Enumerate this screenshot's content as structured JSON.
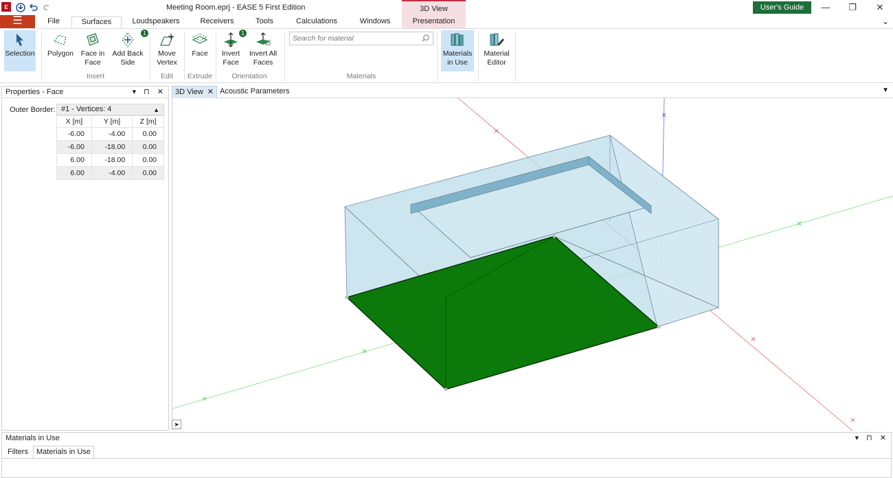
{
  "window": {
    "title": "Meeting Room.eprj - EASE 5 First Edition",
    "context_tab_group": "3D View",
    "users_guide": "User's Guide",
    "controls": {
      "minimize": "—",
      "restore": "❐",
      "close": "✕"
    }
  },
  "menu_tabs": [
    {
      "label": "File"
    },
    {
      "label": "Surfaces"
    },
    {
      "label": "Loudspeakers"
    },
    {
      "label": "Receivers"
    },
    {
      "label": "Tools"
    },
    {
      "label": "Calculations"
    },
    {
      "label": "Windows"
    },
    {
      "label": "Presentation"
    }
  ],
  "ribbon": {
    "selection": "Selection",
    "polygon": "Polygon",
    "face_in_face_1": "Face in",
    "face_in_face_2": "Face",
    "add_back_side_1": "Add Back",
    "add_back_side_2": "Side",
    "move_vertex_1": "Move",
    "move_vertex_2": "Vertex",
    "face": "Face",
    "invert_face_1": "Invert",
    "invert_face_2": "Face",
    "invert_all_1": "Invert All",
    "invert_all_2": "Faces",
    "materials_in_use_1": "Materials",
    "materials_in_use_2": "in Use",
    "material_editor_1": "Material",
    "material_editor_2": "Editor",
    "badge_add_back": "1",
    "badge_invert": "1",
    "groups": {
      "insert": "Insert",
      "edit": "Edit",
      "extrude": "Extrude",
      "orientation": "Orientation",
      "materials": "Materials"
    },
    "search_placeholder": "Search for material"
  },
  "properties": {
    "title": "Properties - Face",
    "controls": "▾ ⊓ ✕",
    "outer_border_label": "Outer Border:",
    "outer_border_value": "#1 - Vertices: 4",
    "columns": [
      "X [m]",
      "Y [m]",
      "Z [m]"
    ],
    "rows": [
      [
        "-6.00",
        "-4.00",
        "0.00"
      ],
      [
        "-6.00",
        "-18.00",
        "0.00"
      ],
      [
        "6.00",
        "-18.00",
        "0.00"
      ],
      [
        "6.00",
        "-4.00",
        "0.00"
      ]
    ]
  },
  "view": {
    "tabs": [
      {
        "label": "3D View"
      },
      {
        "label": "Acoustic Parameters"
      }
    ]
  },
  "bottom": {
    "title": "Materials in Use",
    "controls": "▾ ⊓ ✕",
    "tabs": [
      {
        "label": "Filters"
      },
      {
        "label": "Materials in Use"
      }
    ]
  },
  "colors": {
    "menu_button": "#c43b1d",
    "guide_button": "#1e6d3a",
    "selected_face": "#0b7a0b",
    "room": "#a9d3e3",
    "context_tab": "#f6dfe2"
  }
}
